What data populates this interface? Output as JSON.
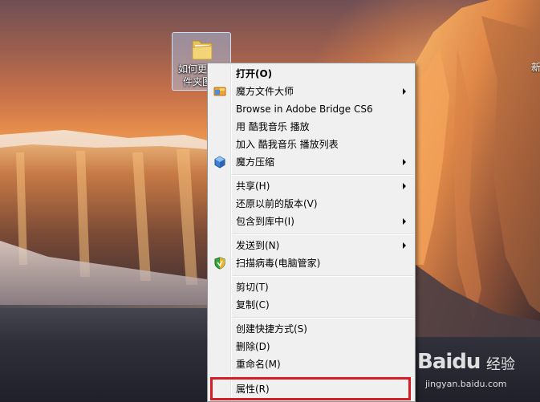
{
  "desktop_icon": {
    "label": "如何更改文件夹图标",
    "icon": "folder-icon"
  },
  "context_menu": {
    "items": [
      {
        "label": "打开(O)",
        "bold": true
      },
      {
        "label": "魔方文件大师",
        "submenu": true,
        "icon": "mofang-master-icon"
      },
      {
        "label": "Browse in Adobe Bridge CS6"
      },
      {
        "label": "用 酷我音乐 播放"
      },
      {
        "label": "加入 酷我音乐 播放列表"
      },
      {
        "label": "魔方压缩",
        "submenu": true,
        "icon": "mofang-compress-icon"
      },
      {
        "label": "共享(H)",
        "submenu": true
      },
      {
        "label": "还原以前的版本(V)"
      },
      {
        "label": "包含到库中(I)",
        "submenu": true
      },
      {
        "label": "发送到(N)",
        "submenu": true
      },
      {
        "label": "扫描病毒(电脑管家)",
        "icon": "tencent-pc-manager-shield-icon"
      },
      {
        "label": "剪切(T)"
      },
      {
        "label": "复制(C)"
      },
      {
        "label": "创建快捷方式(S)"
      },
      {
        "label": "删除(D)"
      },
      {
        "label": "重命名(M)"
      },
      {
        "label": "属性(R)"
      }
    ]
  },
  "watermark": {
    "logo": "Baidu",
    "text": "经验",
    "url": "jingyan.baidu.com"
  },
  "edge_text": "新",
  "colors": {
    "menu_bg": "#f0f0f0",
    "highlight_border": "#d21e24",
    "menu_border": "#979797"
  }
}
